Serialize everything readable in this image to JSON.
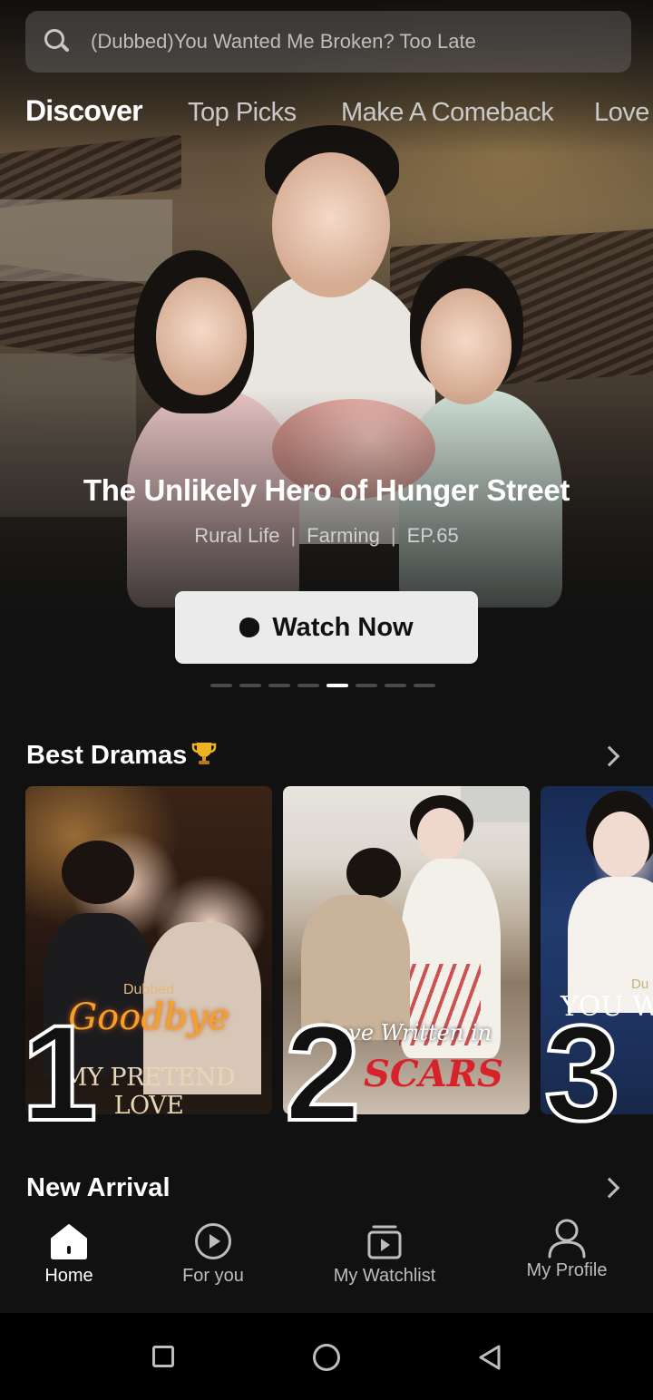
{
  "search": {
    "placeholder": "(Dubbed)You Wanted Me Broken? Too Late"
  },
  "tabs": [
    {
      "label": "Discover",
      "active": true
    },
    {
      "label": "Top Picks"
    },
    {
      "label": "Make A Comeback"
    },
    {
      "label": "Love"
    }
  ],
  "hero": {
    "title": "The Unlikely Hero of Hunger Street",
    "tags": [
      "Rural Life",
      "Farming",
      "EP.65"
    ],
    "button_label": "Watch Now",
    "carousel": {
      "count": 8,
      "active_index": 4
    }
  },
  "best_dramas": {
    "title": "Best Dramas",
    "items": [
      {
        "rank": "1",
        "badge": "Dubbed",
        "title_script": "Goodbye",
        "title_line": "MY PRETEND LOVE"
      },
      {
        "rank": "2",
        "title_script": "Love Written in",
        "title_line": "SCARS"
      },
      {
        "rank": "3",
        "badge": "Du",
        "title_line": "YOU WA"
      }
    ]
  },
  "new_arrival": {
    "title": "New Arrival"
  },
  "bottom_nav": [
    {
      "label": "Home",
      "icon": "home-icon",
      "active": true
    },
    {
      "label": "For you",
      "icon": "play-circle-icon"
    },
    {
      "label": "My Watchlist",
      "icon": "watchlist-icon"
    },
    {
      "label": "My Profile",
      "icon": "profile-icon"
    }
  ],
  "colors": {
    "background": "#111111",
    "button_bg": "#ebebeb",
    "accent_red": "#d8222a"
  }
}
